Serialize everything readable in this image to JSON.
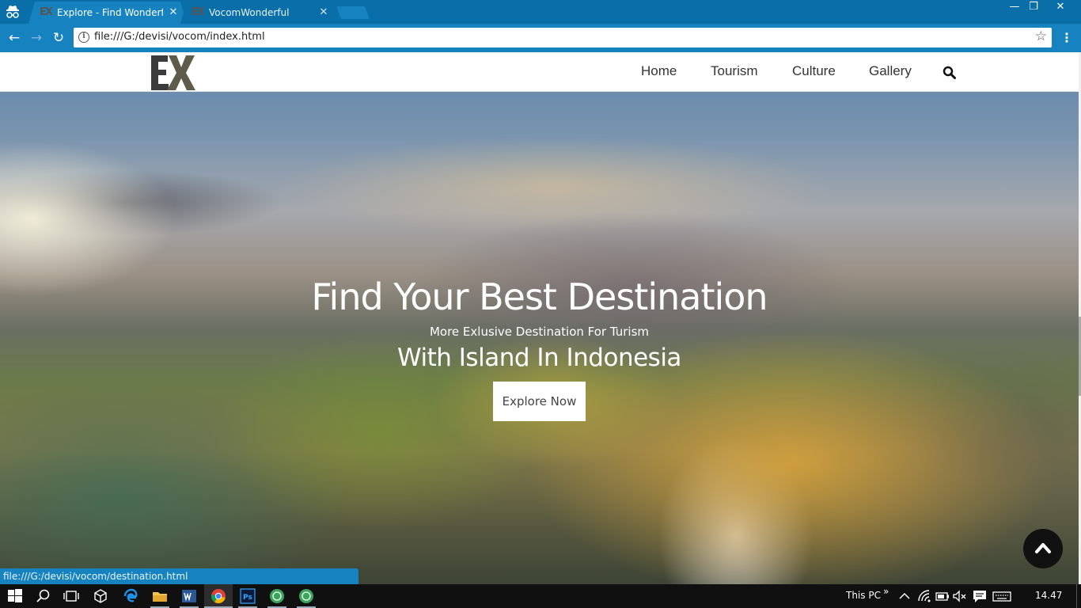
{
  "browser": {
    "tabs": [
      {
        "title": "Explore - Find Wonderful",
        "active": true
      },
      {
        "title": "VocomWonderful",
        "active": false
      }
    ],
    "tab_favicon": "EX",
    "close_symbol": "✕",
    "window_controls": {
      "minimize": "—",
      "restore": "❐",
      "close": "✕"
    },
    "nav": {
      "back": "←",
      "forward": "→",
      "reload": "↻"
    },
    "address": "file:///G:/devisi/vocom/index.html",
    "star": "☆",
    "menu": "⋮",
    "status_url": "file:///G:/devisi/vocom/destination.html"
  },
  "site": {
    "nav": [
      "Home",
      "Tourism",
      "Culture",
      "Gallery"
    ],
    "hero": {
      "title": "Find Your Best Destination",
      "subtitle": "More Exlusive Destination For Turism",
      "tagline": "With Island In Indonesia",
      "button": "Explore Now"
    }
  },
  "taskbar": {
    "tray_label": "This PC",
    "tray_chevron": "»",
    "time": "14.47"
  },
  "colors": {
    "chrome_blue": "#1683c0",
    "tab_strip": "#0a6fa8",
    "logo_dark": "#3b3b3b",
    "logo_olive": "#5e5c48"
  }
}
